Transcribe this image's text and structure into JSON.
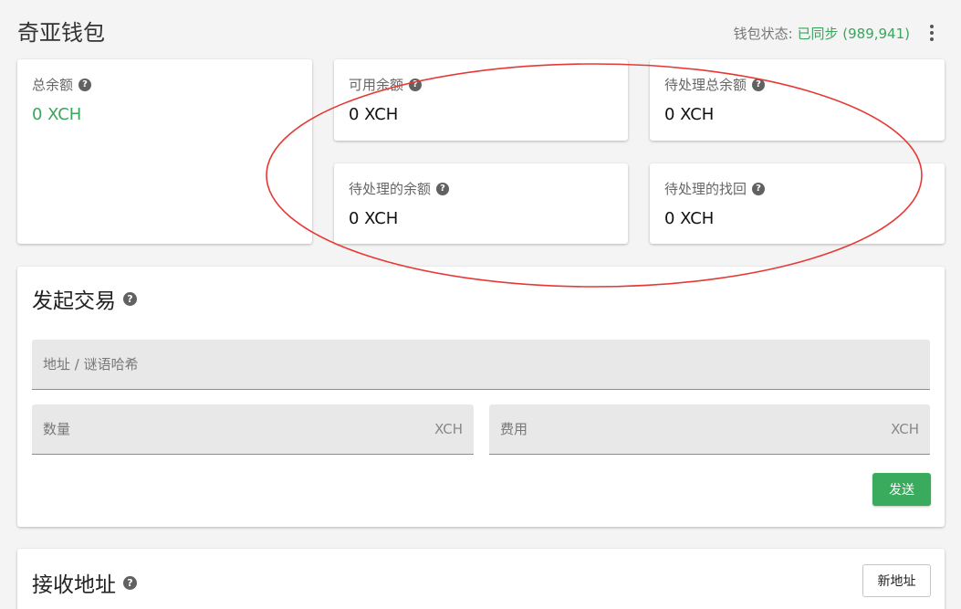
{
  "header": {
    "title": "奇亚钱包",
    "sync_label": "钱包状态:",
    "sync_value": "已同步 (989,941)",
    "more_icon": "more-vert-icon"
  },
  "balances": [
    {
      "label": "总余额",
      "value": "0 XCH",
      "highlight": true
    },
    {
      "label": "可用余额",
      "value": "0 XCH"
    },
    {
      "label": "待处理总余额",
      "value": "0 XCH"
    },
    {
      "label": "待处理的余额",
      "value": "0 XCH"
    },
    {
      "label": "待处理的找回",
      "value": "0 XCH"
    }
  ],
  "send": {
    "title": "发起交易",
    "address_placeholder": "地址 / 谜语哈希",
    "amount_placeholder": "数量",
    "amount_unit": "XCH",
    "fee_placeholder": "费用",
    "fee_unit": "XCH",
    "send_label": "发送"
  },
  "receive": {
    "title": "接收地址",
    "new_address_label": "新地址"
  },
  "help_glyph": "?",
  "colors": {
    "accent_green": "#3aa55d",
    "button_green": "#3aaa5c",
    "annotation_red": "#e53935"
  }
}
